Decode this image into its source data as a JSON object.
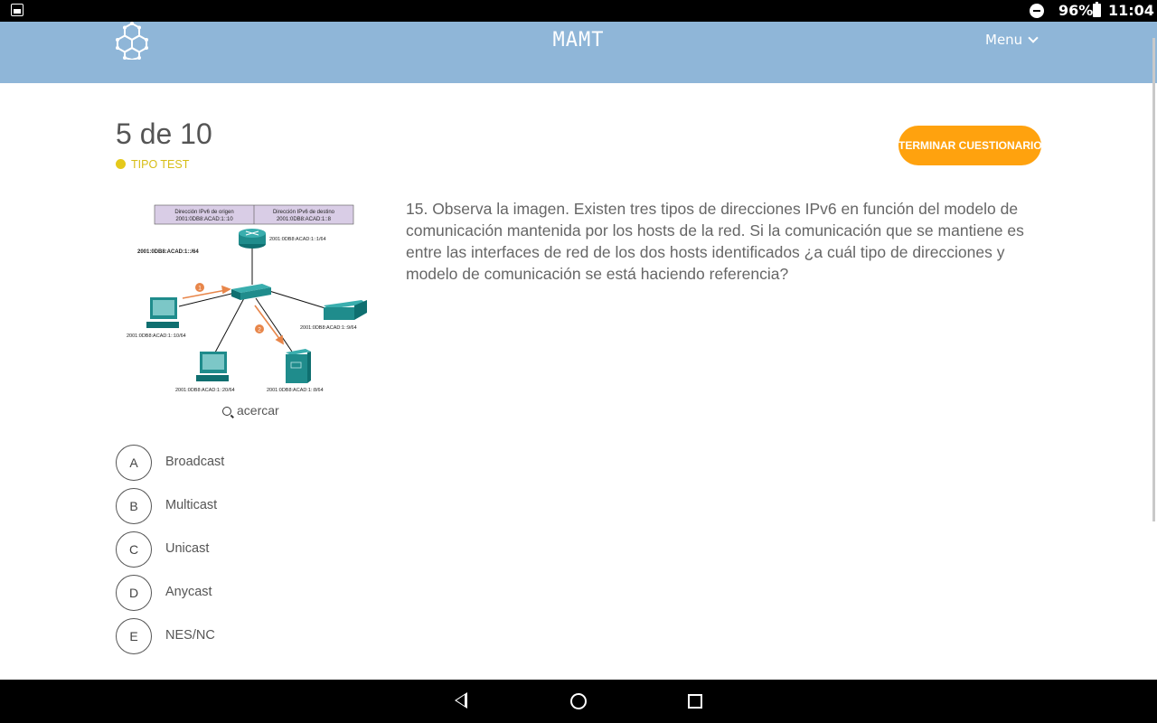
{
  "status_bar": {
    "battery": "96%",
    "time": "11:04"
  },
  "header": {
    "title": "MAMT",
    "menu_label": "Menu"
  },
  "quiz": {
    "progress": "5 de 10",
    "type_label": "TIPO TEST",
    "finish_label": "TERMINAR CUESTIONARIO",
    "zoom_label": "acercar",
    "question": "15. Observa la imagen. Existen tres tipos de direcciones IPv6 en función del modelo de comunicación mantenida por los hosts de la red. Si la comunicación que se mantiene es entre las interfaces de red de los dos hosts identificados ¿a cuál tipo de direcciones y modelo de comunicación se está haciendo referencia?",
    "options": [
      {
        "letter": "A",
        "text": "Broadcast"
      },
      {
        "letter": "B",
        "text": "Multicast"
      },
      {
        "letter": "C",
        "text": "Unicast"
      },
      {
        "letter": "D",
        "text": "Anycast"
      },
      {
        "letter": "E",
        "text": "NES/NC"
      }
    ]
  },
  "figure": {
    "header_src": "Dirección IPv6 de origen",
    "header_src_addr": "2001:0DB8:ACAD:1::10",
    "header_dst": "Dirección IPv6 de destino",
    "header_dst_addr": "2001:0DB8:ACAD:1::8",
    "router_addr": "2001:0DB8:ACAD:1::1/64",
    "network": "2001:0DB8:ACAD:1::/64",
    "host_left_addr": "2001:0DB8:ACAD:1::10/64",
    "printer_addr": "2001:0DB8:ACAD:1::9/64",
    "host_bottom_addr": "2001:0DB8:ACAD:1::20/64",
    "server_addr": "2001:0DB8:ACAD:1::8/64",
    "step1": "1",
    "step2": "2"
  },
  "colors": {
    "header_bg": "#8fb6d8",
    "accent": "#ffa20e",
    "type_dot": "#e5c91b",
    "device": "#1f8c8c",
    "arrow": "#e8864a"
  }
}
